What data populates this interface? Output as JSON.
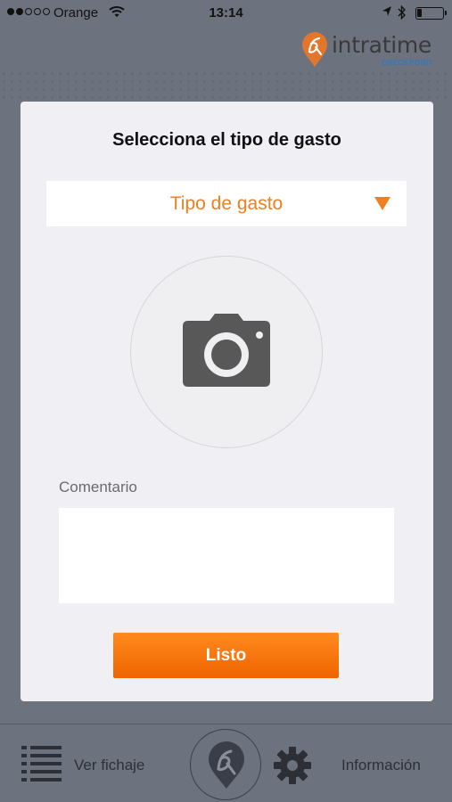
{
  "status_bar": {
    "carrier": "Orange",
    "time": "13:14",
    "signal_bars_on": 2,
    "signal_bars_total": 5,
    "icons": [
      "wifi-icon",
      "location-arrow-icon",
      "bluetooth-icon",
      "battery-icon"
    ]
  },
  "logo": {
    "name": "intratime",
    "subtitle": "CHECKPOINT",
    "brand_color": "#f07f1f"
  },
  "modal": {
    "title": "Selecciona el tipo de gasto",
    "expense_type_select": {
      "label": "Tipo de gasto",
      "icon": "triangle-down-icon"
    },
    "photo_button_icon": "camera-icon",
    "comment": {
      "label": "Comentario",
      "value": ""
    },
    "done_label": "Listo"
  },
  "tabbar": {
    "ver_fichaje": "Ver fichaje",
    "informacion": "Información",
    "icons": [
      "list-icon",
      "intratime-logo-icon",
      "gear-icon"
    ]
  },
  "colors": {
    "accent": "#f07f1f",
    "button_top": "#ff8a1e",
    "button_bottom": "#ef6400",
    "overlay": "#464e5c",
    "modal_bg": "#efeff4"
  }
}
